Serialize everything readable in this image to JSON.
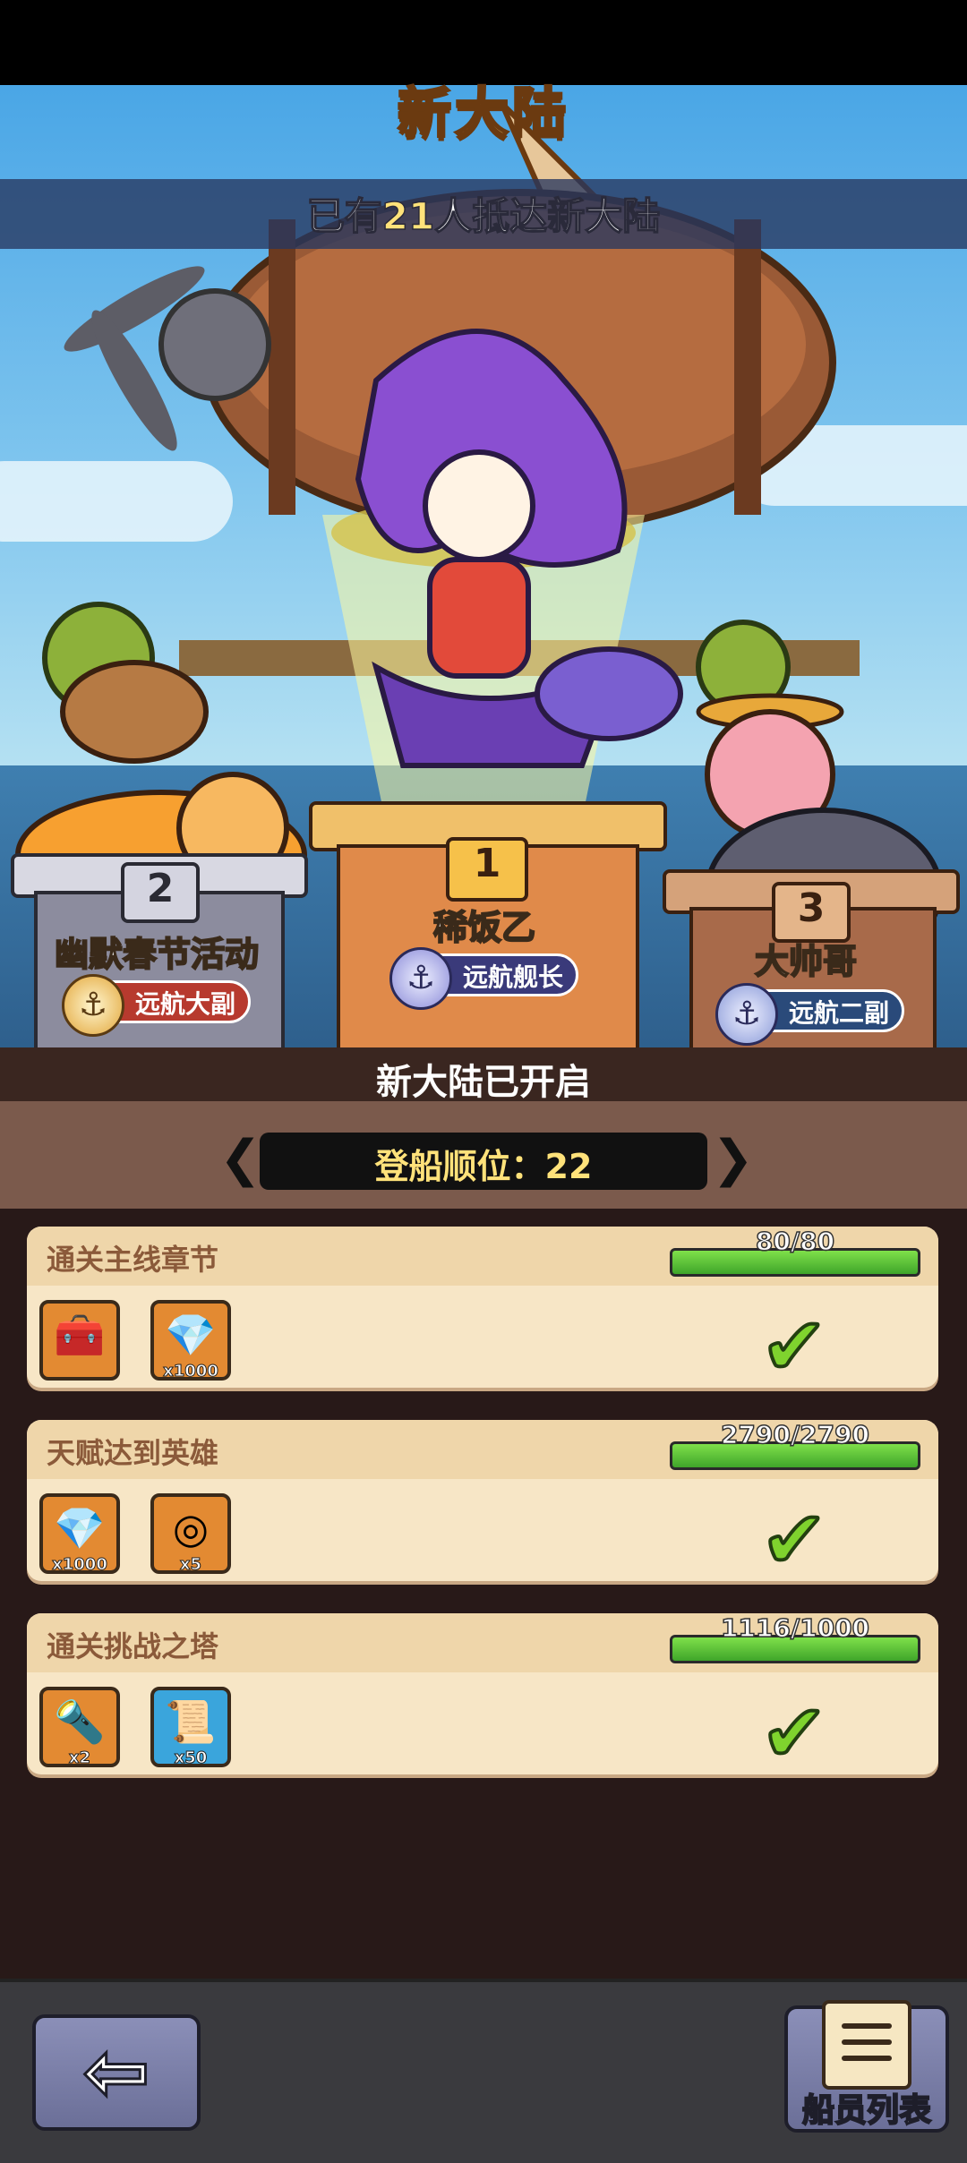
{
  "scene": {
    "title": "新大陆",
    "banner_prefix": "已有",
    "banner_count": "21",
    "banner_suffix": "人抵达新大陆"
  },
  "podium": {
    "second": {
      "rank": "2",
      "name": "幽默春节活动",
      "role": "远航大副"
    },
    "first": {
      "rank": "1",
      "name": "稀饭乙",
      "role": "远航舰长"
    },
    "third": {
      "rank": "3",
      "name": "大帅哥",
      "role": "远航二副"
    }
  },
  "status": {
    "open_text": "新大陆已开启",
    "rank_label": "登船顺位：22"
  },
  "tasks": [
    {
      "title": "通关主线章节",
      "progress_text": "80/80",
      "progress": 1.0,
      "rewards": [
        {
          "icon": "purple-chest-icon",
          "qty": ""
        },
        {
          "icon": "purple-gem-icon",
          "qty": "x1000"
        }
      ]
    },
    {
      "title": "天赋达到英雄",
      "progress_text": "2790/2790",
      "progress": 1.0,
      "rewards": [
        {
          "icon": "purple-gem-icon",
          "qty": "x1000"
        },
        {
          "icon": "silver-coin-icon",
          "qty": "x5"
        }
      ]
    },
    {
      "title": "通关挑战之塔",
      "progress_text": "1116/1000",
      "progress": 1.0,
      "rewards": [
        {
          "icon": "purple-torch-icon",
          "qty": "x2"
        },
        {
          "icon": "scroll-icon",
          "qty": "x50"
        }
      ]
    }
  ],
  "bottom": {
    "crew_label": "船员列表"
  }
}
